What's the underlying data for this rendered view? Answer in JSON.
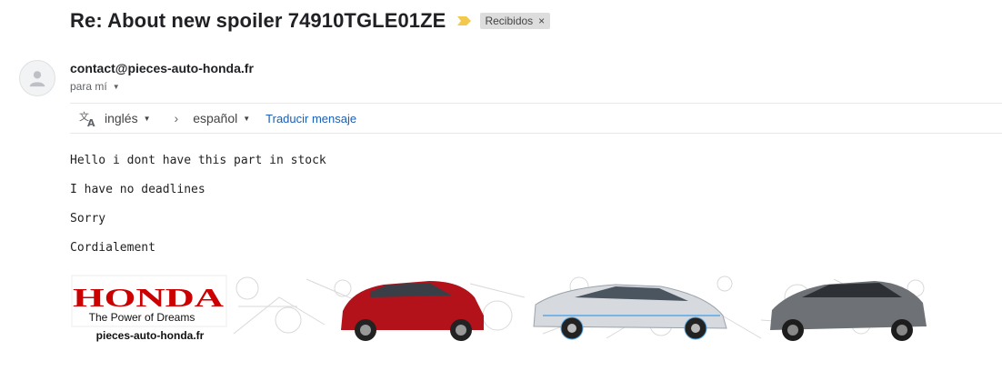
{
  "email": {
    "subject": "Re: About new spoiler 74910TGLE01ZE",
    "label": "Recibidos",
    "label_remove": "×",
    "sender": "contact@pieces-auto-honda.fr",
    "recipient": "para mí"
  },
  "translate": {
    "from_lang": "inglés",
    "to_lang": "español",
    "arrow": "›",
    "link": "Traducir mensaje"
  },
  "body": {
    "lines": [
      "Hello i dont have this part in stock",
      "I have no deadlines",
      "Sorry",
      "Cordialement"
    ]
  },
  "banner": {
    "brand": "HONDA",
    "tagline": "The Power of Dreams",
    "site": "pieces-auto-honda.fr"
  },
  "colors": {
    "brand_red": "#cc0000",
    "link_blue": "#1a5fb4",
    "importance_yellow": "#f2c94c",
    "chip_bg": "#dddddd"
  }
}
